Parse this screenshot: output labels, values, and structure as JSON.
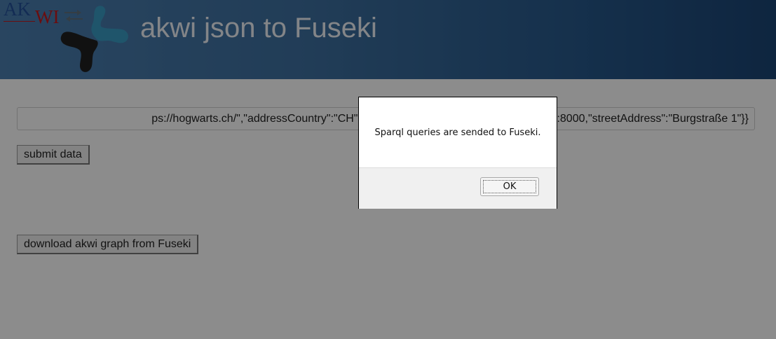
{
  "header": {
    "title": "akwi json to Fuseki",
    "logo": {
      "text_ak": "AK",
      "text_wi": "WI",
      "icon": "swap-arrows-icon",
      "mark": "tri-blob-logo-icon"
    }
  },
  "form": {
    "json_input_value": "ps://hogwarts.ch/\",\"addressCountry\":\"CH\",\"addressLocality\":\"Zürich\",\"postalCode\":8000,\"streetAddress\":\"Burgstraße 1\"}}",
    "submit_label": "submit data",
    "download_label": "download akwi graph from Fuseki"
  },
  "dialog": {
    "message": "Sparql queries are sended to Fuseki.",
    "ok_label": "OK"
  },
  "colors": {
    "header_start": "#4b7fb0",
    "header_end": "#1b4474",
    "logo_blue": "#24509a",
    "logo_red": "#c2191d",
    "logo_teal": "#3a9cc4",
    "logo_dark": "#1f1f1f"
  }
}
